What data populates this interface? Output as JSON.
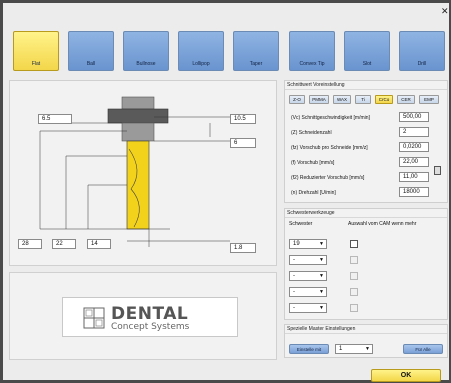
{
  "toolbar": {
    "tools": [
      {
        "label": "Flat"
      },
      {
        "label": "Ball"
      },
      {
        "label": "Bullnose"
      },
      {
        "label": "Lollipop"
      },
      {
        "label": "Taper"
      },
      {
        "label": "Convex Tip"
      },
      {
        "label": "Slot"
      },
      {
        "label": "Drill"
      }
    ]
  },
  "dimensions": {
    "d1": "6.5",
    "d2": "10.5",
    "d3": "6",
    "d4": "28",
    "d5": "22",
    "d6": "14",
    "d7": "1.8"
  },
  "logo": {
    "name": "DENTAL",
    "sub": "Concept Systems"
  },
  "cutting": {
    "title": "Schnittwert Voreinstellung",
    "materials": [
      "Z-O",
      "PMMA",
      "WAX",
      "Ti",
      "CrCo",
      "CER",
      "EMP"
    ],
    "rows": [
      {
        "label": "(Vc) Schnittgeschwindigkeit [m/min]",
        "value": "500,00"
      },
      {
        "label": "(Z) Schneidenzahl",
        "value": "2"
      },
      {
        "label": "(fz) Vorschub pro Schneide [mm/z]",
        "value": "0,0200"
      },
      {
        "label": "(f) Vorschub [mm/s]",
        "value": "22,00"
      },
      {
        "label": "(f2) Reduzierter Vorschub [mm/s]",
        "value": "11,00"
      },
      {
        "label": "(n) Drehzahl [U/min]",
        "value": "18000"
      }
    ]
  },
  "sister": {
    "title": "Schwesterwerkzeuge",
    "col1": "Schwester",
    "col2": "Auswahl vom CAM wenn mehr",
    "rows": [
      {
        "value": "19"
      },
      {
        "value": "-"
      },
      {
        "value": "-"
      },
      {
        "value": "-"
      },
      {
        "value": "-"
      }
    ]
  },
  "special": {
    "title": "Spezielle Master Einstellungen",
    "set_label": "Einstelle mit",
    "select_value": "1",
    "for_all_label": "Für Alle"
  },
  "footer": {
    "ok_label": "OK"
  },
  "colors": {
    "accent_yellow": "#f3d64a",
    "tool_blue": "#7aa0d6"
  }
}
